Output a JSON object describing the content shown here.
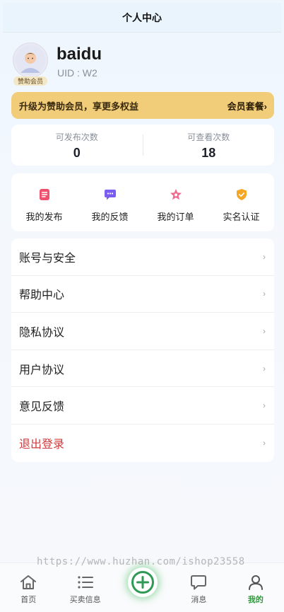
{
  "header": {
    "title": "个人中心"
  },
  "profile": {
    "username": "baidu",
    "uid_text": "UID : W2",
    "vip_tag": "赞助会员"
  },
  "banner": {
    "text": "升级为赞助会员，享更多权益",
    "link": "会员套餐›"
  },
  "stats": [
    {
      "label": "可发布次数",
      "value": "0"
    },
    {
      "label": "可查看次数",
      "value": "18"
    }
  ],
  "shortcuts": [
    {
      "label": "我的发布",
      "icon": "publish-icon",
      "color": "#f0506e"
    },
    {
      "label": "我的反馈",
      "icon": "feedback-icon",
      "color": "#7a5cf0"
    },
    {
      "label": "我的订单",
      "icon": "order-star-icon",
      "color": "#f06b8e"
    },
    {
      "label": "实名认证",
      "icon": "verify-shield-icon",
      "color": "#f5a623"
    }
  ],
  "menu": [
    {
      "label": "账号与安全"
    },
    {
      "label": "帮助中心"
    },
    {
      "label": "隐私协议"
    },
    {
      "label": "用户协议"
    },
    {
      "label": "意见反馈"
    },
    {
      "label": "退出登录"
    }
  ],
  "menu_chevron": "›",
  "tabbar": [
    {
      "label": "首页",
      "icon": "home-icon"
    },
    {
      "label": "买卖信息",
      "icon": "list-icon"
    },
    {
      "label": "",
      "icon": "add-circle-icon"
    },
    {
      "label": "消息",
      "icon": "message-icon"
    },
    {
      "label": "我的",
      "icon": "user-icon",
      "active": true
    }
  ],
  "colors": {
    "accent_green": "#2e9a3c",
    "banner_gold": "#f1cd79",
    "logout_red": "#d0393a"
  },
  "watermark": "https://www.huzhan.com/ishop23558"
}
